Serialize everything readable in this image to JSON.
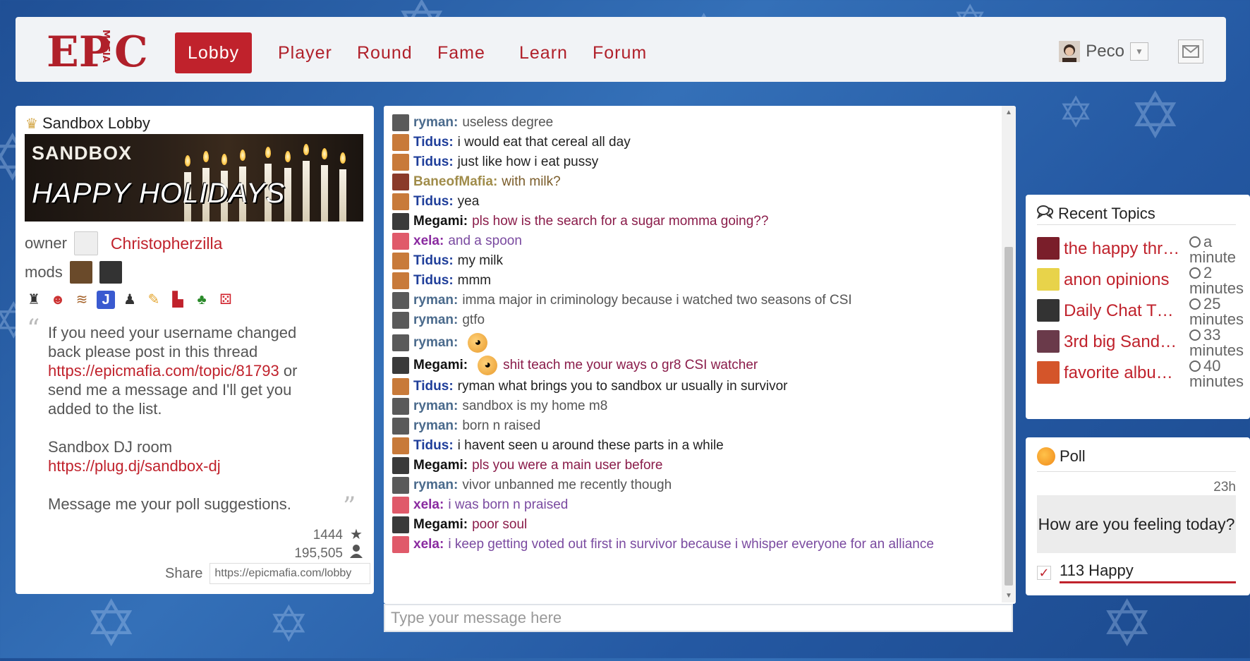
{
  "nav": {
    "logo_main": "EP",
    "logo_c": "C",
    "logo_vertical": "MAFIA",
    "items": [
      {
        "label": "Lobby",
        "active": true
      },
      {
        "label": "Player"
      },
      {
        "label": "Round"
      },
      {
        "label": "Fame"
      },
      {
        "label": "Learn"
      },
      {
        "label": "Forum"
      }
    ],
    "username": "Peco",
    "dropdown_icon": "caret-down-icon",
    "mail_icon": "envelope-icon"
  },
  "lobby": {
    "title": "Sandbox Lobby",
    "title_icon": "cake-icon",
    "banner_top": "SANDBOX",
    "banner_bottom": "HAPPY HOLIDAYS",
    "owner_label": "owner",
    "owner_name": "Christopherzilla",
    "mods_label": "mods",
    "description": {
      "line1": "If you need your username changed back please post in this thread",
      "link1": "https://epicmafia.com/topic/81793",
      "line2": " or send me a message and I'll get you added to the list.",
      "line3": "Sandbox DJ room",
      "link2": "https://plug.dj/sandbox-dj",
      "line4": "Message me your poll suggestions."
    },
    "likes": "1444",
    "members": "195,505",
    "share_label": "Share",
    "share_url": "https://epicmafia.com/lobby"
  },
  "chat": {
    "messages": [
      {
        "user": "ryman",
        "text": "useless degree",
        "ucolor": "#4a6a8c",
        "tcolor": "#555555"
      },
      {
        "user": "Tidus",
        "text": "i would eat that cereal all day",
        "ucolor": "#1f3e9a",
        "tcolor": "#222222"
      },
      {
        "user": "Tidus",
        "text": "just like how i eat pussy",
        "ucolor": "#1f3e9a",
        "tcolor": "#222222"
      },
      {
        "user": "BaneofMafia",
        "text": "with milk?",
        "ucolor": "#a08c4a",
        "tcolor": "#7a5c2a"
      },
      {
        "user": "Tidus",
        "text": "yea",
        "ucolor": "#1f3e9a",
        "tcolor": "#222222"
      },
      {
        "user": "Megami",
        "text": "pls how is the search for a sugar momma going??",
        "ucolor": "#111111",
        "tcolor": "#8a1c4a"
      },
      {
        "user": "xela",
        "text": "and a spoon",
        "ucolor": "#8a2aa0",
        "tcolor": "#7a4aa0"
      },
      {
        "user": "Tidus",
        "text": "my milk",
        "ucolor": "#1f3e9a",
        "tcolor": "#222222"
      },
      {
        "user": "Tidus",
        "text": "mmm",
        "ucolor": "#1f3e9a",
        "tcolor": "#222222"
      },
      {
        "user": "ryman",
        "text": "imma major in criminology because i watched two seasons of CSI",
        "ucolor": "#4a6a8c",
        "tcolor": "#555555"
      },
      {
        "user": "ryman",
        "text": "gtfo",
        "ucolor": "#4a6a8c",
        "tcolor": "#555555"
      },
      {
        "user": "ryman",
        "text": "",
        "ucolor": "#4a6a8c",
        "tcolor": "#555555",
        "emoji": true
      },
      {
        "user": "Megami",
        "text": "shit teach me your ways o gr8 CSI watcher",
        "ucolor": "#111111",
        "tcolor": "#8a1c4a",
        "emoji": true
      },
      {
        "user": "Tidus",
        "text": "ryman what brings you to sandbox ur usually in survivor",
        "ucolor": "#1f3e9a",
        "tcolor": "#222222"
      },
      {
        "user": "ryman",
        "text": "sandbox is my home m8",
        "ucolor": "#4a6a8c",
        "tcolor": "#555555"
      },
      {
        "user": "ryman",
        "text": "born n raised",
        "ucolor": "#4a6a8c",
        "tcolor": "#555555"
      },
      {
        "user": "Tidus",
        "text": "i havent seen u around these parts in a while",
        "ucolor": "#1f3e9a",
        "tcolor": "#222222"
      },
      {
        "user": "Megami",
        "text": "pls you were a main user before",
        "ucolor": "#111111",
        "tcolor": "#8a1c4a"
      },
      {
        "user": "ryman",
        "text": "vivor unbanned me recently though",
        "ucolor": "#4a6a8c",
        "tcolor": "#555555"
      },
      {
        "user": "xela",
        "text": "i was born n praised",
        "ucolor": "#8a2aa0",
        "tcolor": "#7a4aa0"
      },
      {
        "user": "Megami",
        "text": "poor soul",
        "ucolor": "#111111",
        "tcolor": "#8a1c4a"
      },
      {
        "user": "xela",
        "text": "i keep getting voted out first in survivor because i whisper everyone for an alliance",
        "ucolor": "#8a2aa0",
        "tcolor": "#7a4aa0"
      }
    ],
    "input_placeholder": "Type your message here"
  },
  "recent_topics": {
    "title": "Recent Topics",
    "icon": "speech-bubbles-icon",
    "items": [
      {
        "title": "the happy thr…",
        "time_num": "a",
        "time_unit": "minute",
        "av": "#7a1e2a"
      },
      {
        "title": "anon opinions",
        "time_num": "2",
        "time_unit": "minutes",
        "av": "#e8d34a"
      },
      {
        "title": "Daily Chat T…",
        "time_num": "25",
        "time_unit": "minutes",
        "av": "#333333"
      },
      {
        "title": "3rd big Sand…",
        "time_num": "33",
        "time_unit": "minutes",
        "av": "#6a3a4a"
      },
      {
        "title": "favorite albu…",
        "time_num": "40",
        "time_unit": "minutes",
        "av": "#d4552a"
      }
    ]
  },
  "poll": {
    "title": "Poll",
    "icon": "orange-ball-icon",
    "time": "23h",
    "question": "How are you feeling today?",
    "option": "113 Happy",
    "check_icon": "checkmark-icon"
  }
}
